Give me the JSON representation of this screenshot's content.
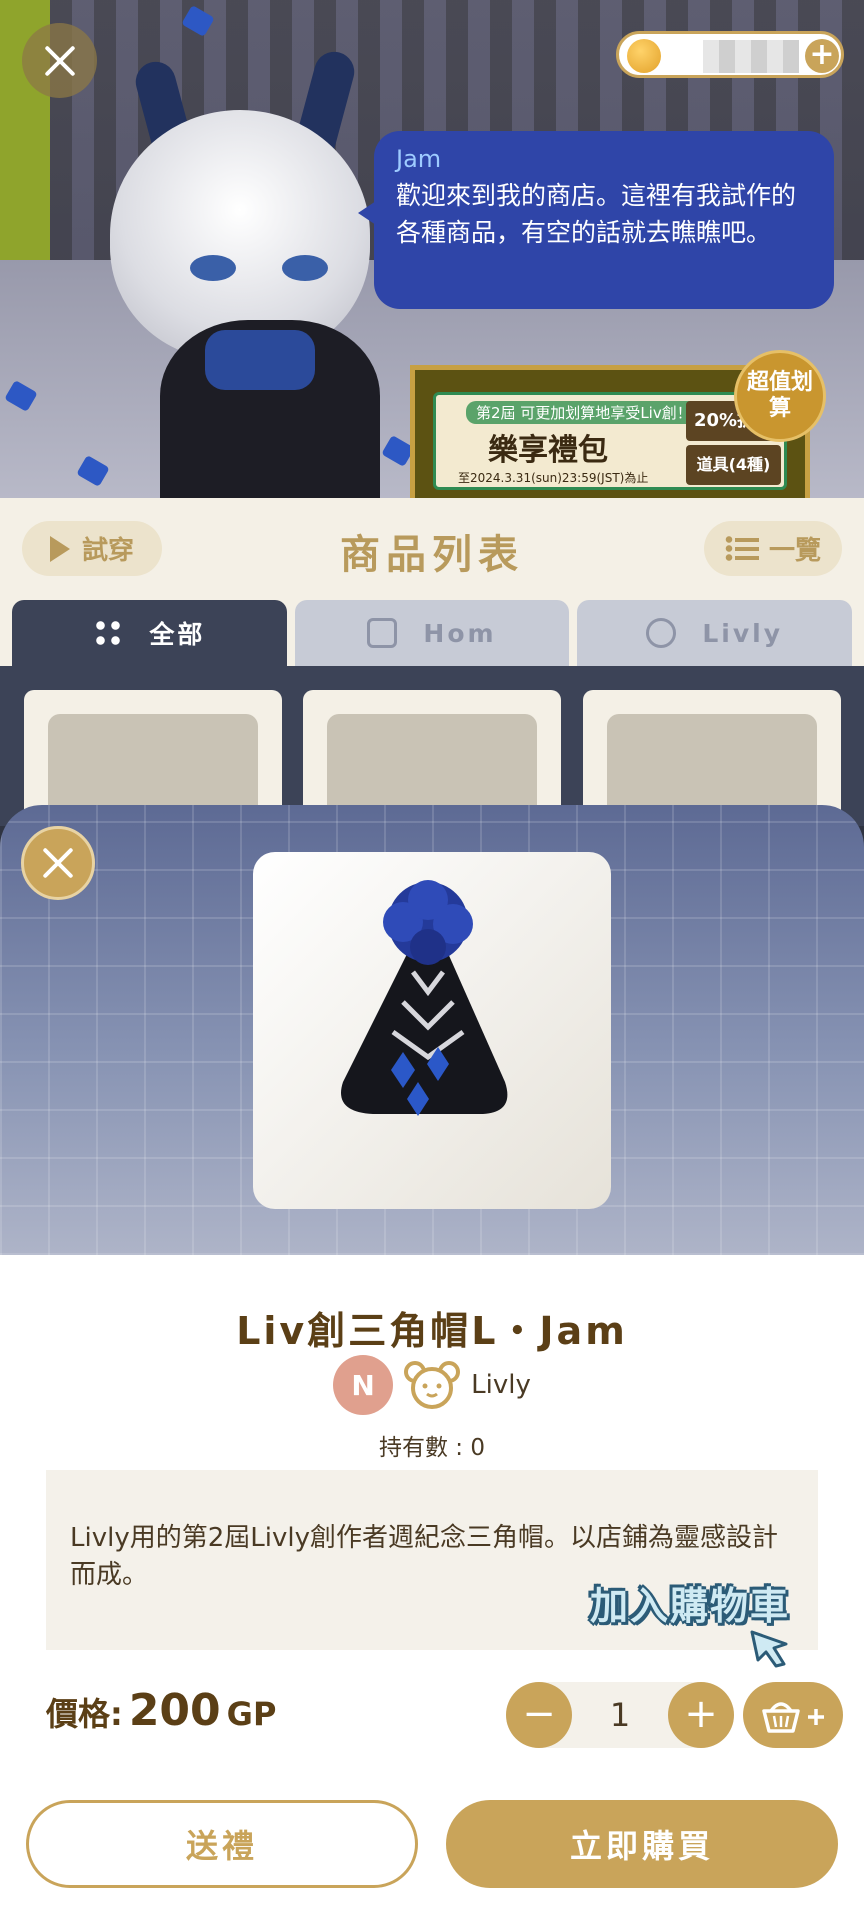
{
  "scene": {
    "speech": {
      "name": "Jam",
      "text": "歡迎來到我的商店。這裡有我試作的各種商品，有空的話就去瞧瞧吧。"
    },
    "banner": {
      "tag": "第2屆 可更加划算地享受Liv創！",
      "title": "樂享禮包",
      "date": "至2024.3.31(sun)23:59(JST)為止",
      "discount": "20%折扣",
      "item": "道具(4種)",
      "badge": "超值划算"
    }
  },
  "header": {
    "try_on": "試穿",
    "title": "商品列表",
    "list_view": "一覽"
  },
  "tabs": [
    {
      "label": "全部",
      "active": true
    },
    {
      "label": "Hom",
      "active": false
    },
    {
      "label": "Livly",
      "active": false
    }
  ],
  "item": {
    "name": "Liv創三角帽L・Jam",
    "rarity": "N",
    "category": "Livly",
    "owned": "持有數 : 0",
    "description": "Livly用的第2屆Livly創作者週紀念三角帽。以店鋪為靈感設計而成。",
    "price_label": "價格:",
    "price_value": "200",
    "price_unit": "GP",
    "quantity": "1"
  },
  "hint": {
    "add_to_cart": "加入購物車"
  },
  "actions": {
    "gift": "送禮",
    "buy_now": "立即購買"
  },
  "colors": {
    "accent": "#c9a45a",
    "tab_active": "#3c4357",
    "bubble": "#2f45a8"
  }
}
